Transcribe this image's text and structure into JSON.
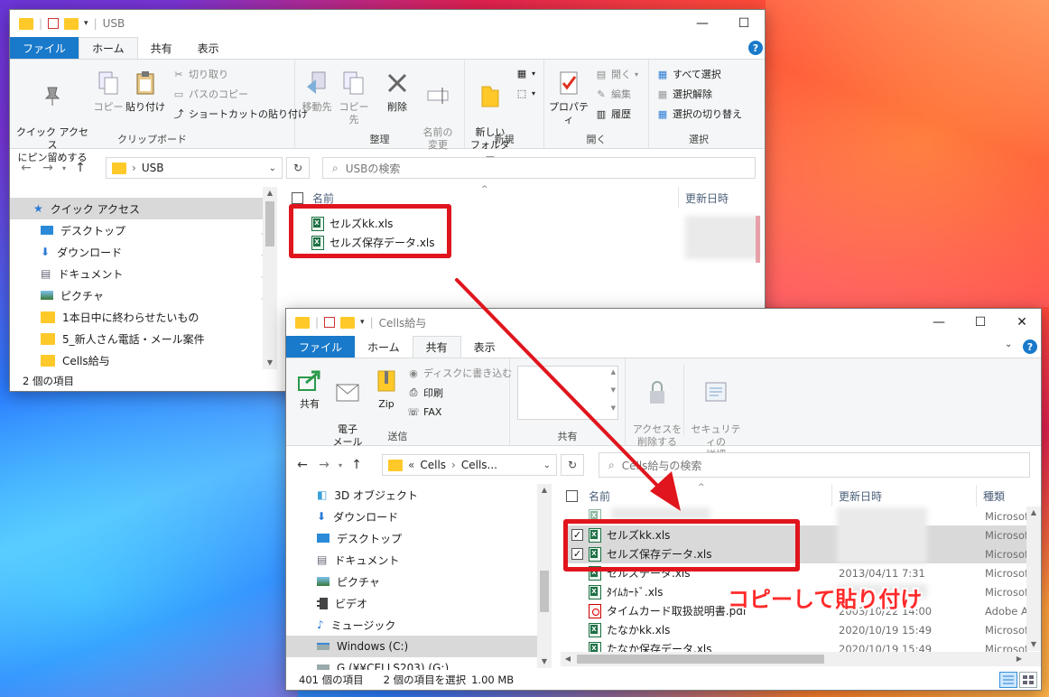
{
  "colors": {
    "file_tab": "#1979ca",
    "annotation_red": "#e0151d",
    "selection": "#d9d9d9"
  },
  "win1": {
    "title": "USB",
    "tabs": [
      "ファイル",
      "ホーム",
      "共有",
      "表示"
    ],
    "ribbon": {
      "clipboard": {
        "pin_quick": "クイック アクセス\nにピン留めする",
        "copy": "コピー",
        "paste": "貼り付け",
        "cut": "切り取り",
        "copy_path": "パスのコピー",
        "paste_shortcut": "ショートカットの貼り付け",
        "label": "クリップボード"
      },
      "organize": {
        "move_to": "移動先",
        "copy_to": "コピー先",
        "delete": "削除",
        "rename": "名前の\n変更",
        "label": "整理"
      },
      "new": {
        "new_folder": "新しい\nフォルダー",
        "label": "新規"
      },
      "open": {
        "properties": "プロパティ",
        "open": "開く",
        "edit": "編集",
        "history": "履歴",
        "label": "開く"
      },
      "select": {
        "select_all": "すべて選択",
        "select_none": "選択解除",
        "invert": "選択の切り替え",
        "label": "選択"
      }
    },
    "address": {
      "path": "USB",
      "search_placeholder": "USBの検索"
    },
    "nav": [
      {
        "label": "クイック アクセス",
        "icon": "star-icon"
      },
      {
        "label": "デスクトップ",
        "icon": "desktop-icon"
      },
      {
        "label": "ダウンロード",
        "icon": "download-icon"
      },
      {
        "label": "ドキュメント",
        "icon": "document-icon"
      },
      {
        "label": "ピクチャ",
        "icon": "picture-icon"
      },
      {
        "label": "1本日中に終わらせたいもの",
        "icon": "folder-icon"
      },
      {
        "label": "5_新人さん電話・メール案件",
        "icon": "folder-icon"
      },
      {
        "label": "Cells給与",
        "icon": "folder-icon"
      }
    ],
    "columns": {
      "name": "名前",
      "modified": "更新日時"
    },
    "files": [
      "セルズkk.xls",
      "セルズ保存データ.xls"
    ],
    "status": "2 個の項目"
  },
  "win2": {
    "title": "Cells給与",
    "tabs": [
      "ファイル",
      "ホーム",
      "共有",
      "表示"
    ],
    "ribbon": {
      "send": {
        "share": "共有",
        "email": "電子\nメール",
        "zip": "Zip",
        "burn": "ディスクに書き込む",
        "print": "印刷",
        "fax": "FAX",
        "label": "送信"
      },
      "share_with": {
        "label": "共有"
      },
      "remove_access": "アクセスを\n削除する",
      "security": "セキュリティの\n詳細"
    },
    "address": {
      "path_1": "Cells",
      "path_2": "Cells...",
      "search_placeholder": "Cells給与の検索"
    },
    "nav": [
      {
        "label": "3D オブジェクト",
        "icon": "cube-icon"
      },
      {
        "label": "ダウンロード",
        "icon": "download-icon"
      },
      {
        "label": "デスクトップ",
        "icon": "desktop-icon"
      },
      {
        "label": "ドキュメント",
        "icon": "document-icon"
      },
      {
        "label": "ピクチャ",
        "icon": "picture-icon"
      },
      {
        "label": "ビデオ",
        "icon": "video-icon"
      },
      {
        "label": "ミュージック",
        "icon": "music-icon"
      },
      {
        "label": "Windows (C:)",
        "icon": "drive-icon"
      },
      {
        "label": "G (¥¥CELLS203) (G:)",
        "icon": "network-drive-icon"
      }
    ],
    "columns": {
      "name": "名前",
      "modified": "更新日時",
      "type": "種類"
    },
    "files": [
      {
        "name": "",
        "date": "",
        "type": "Microsof",
        "icon": "xls"
      },
      {
        "name": "セルズkk.xls",
        "date": "",
        "type": "Microsof",
        "icon": "xls",
        "selected": true
      },
      {
        "name": "セルズ保存データ.xls",
        "date": "",
        "type": "Microsof",
        "icon": "xls",
        "selected": true
      },
      {
        "name": "セルズデータ.xls",
        "date": "2013/04/11 7:31",
        "type": "Microsof",
        "icon": "xls"
      },
      {
        "name": "ﾀｲﾑｶｰﾄﾞ.xls",
        "date": "",
        "type": "Microsof",
        "icon": "xls"
      },
      {
        "name": "タイムカード取扱説明書.pdf",
        "date": "2003/10/22 14:00",
        "type": "Adobe A",
        "icon": "pdf"
      },
      {
        "name": "たなかkk.xls",
        "date": "2020/10/19 15:49",
        "type": "Microsof",
        "icon": "xls"
      },
      {
        "name": "たなか保存データ.xls",
        "date": "2020/10/19 15:49",
        "type": "Microsof",
        "icon": "xls"
      }
    ],
    "status": {
      "count": "401 個の項目",
      "selection": "2 個の項目を選択",
      "size": "1.00 MB"
    }
  },
  "annotation": "コピーして貼り付け"
}
